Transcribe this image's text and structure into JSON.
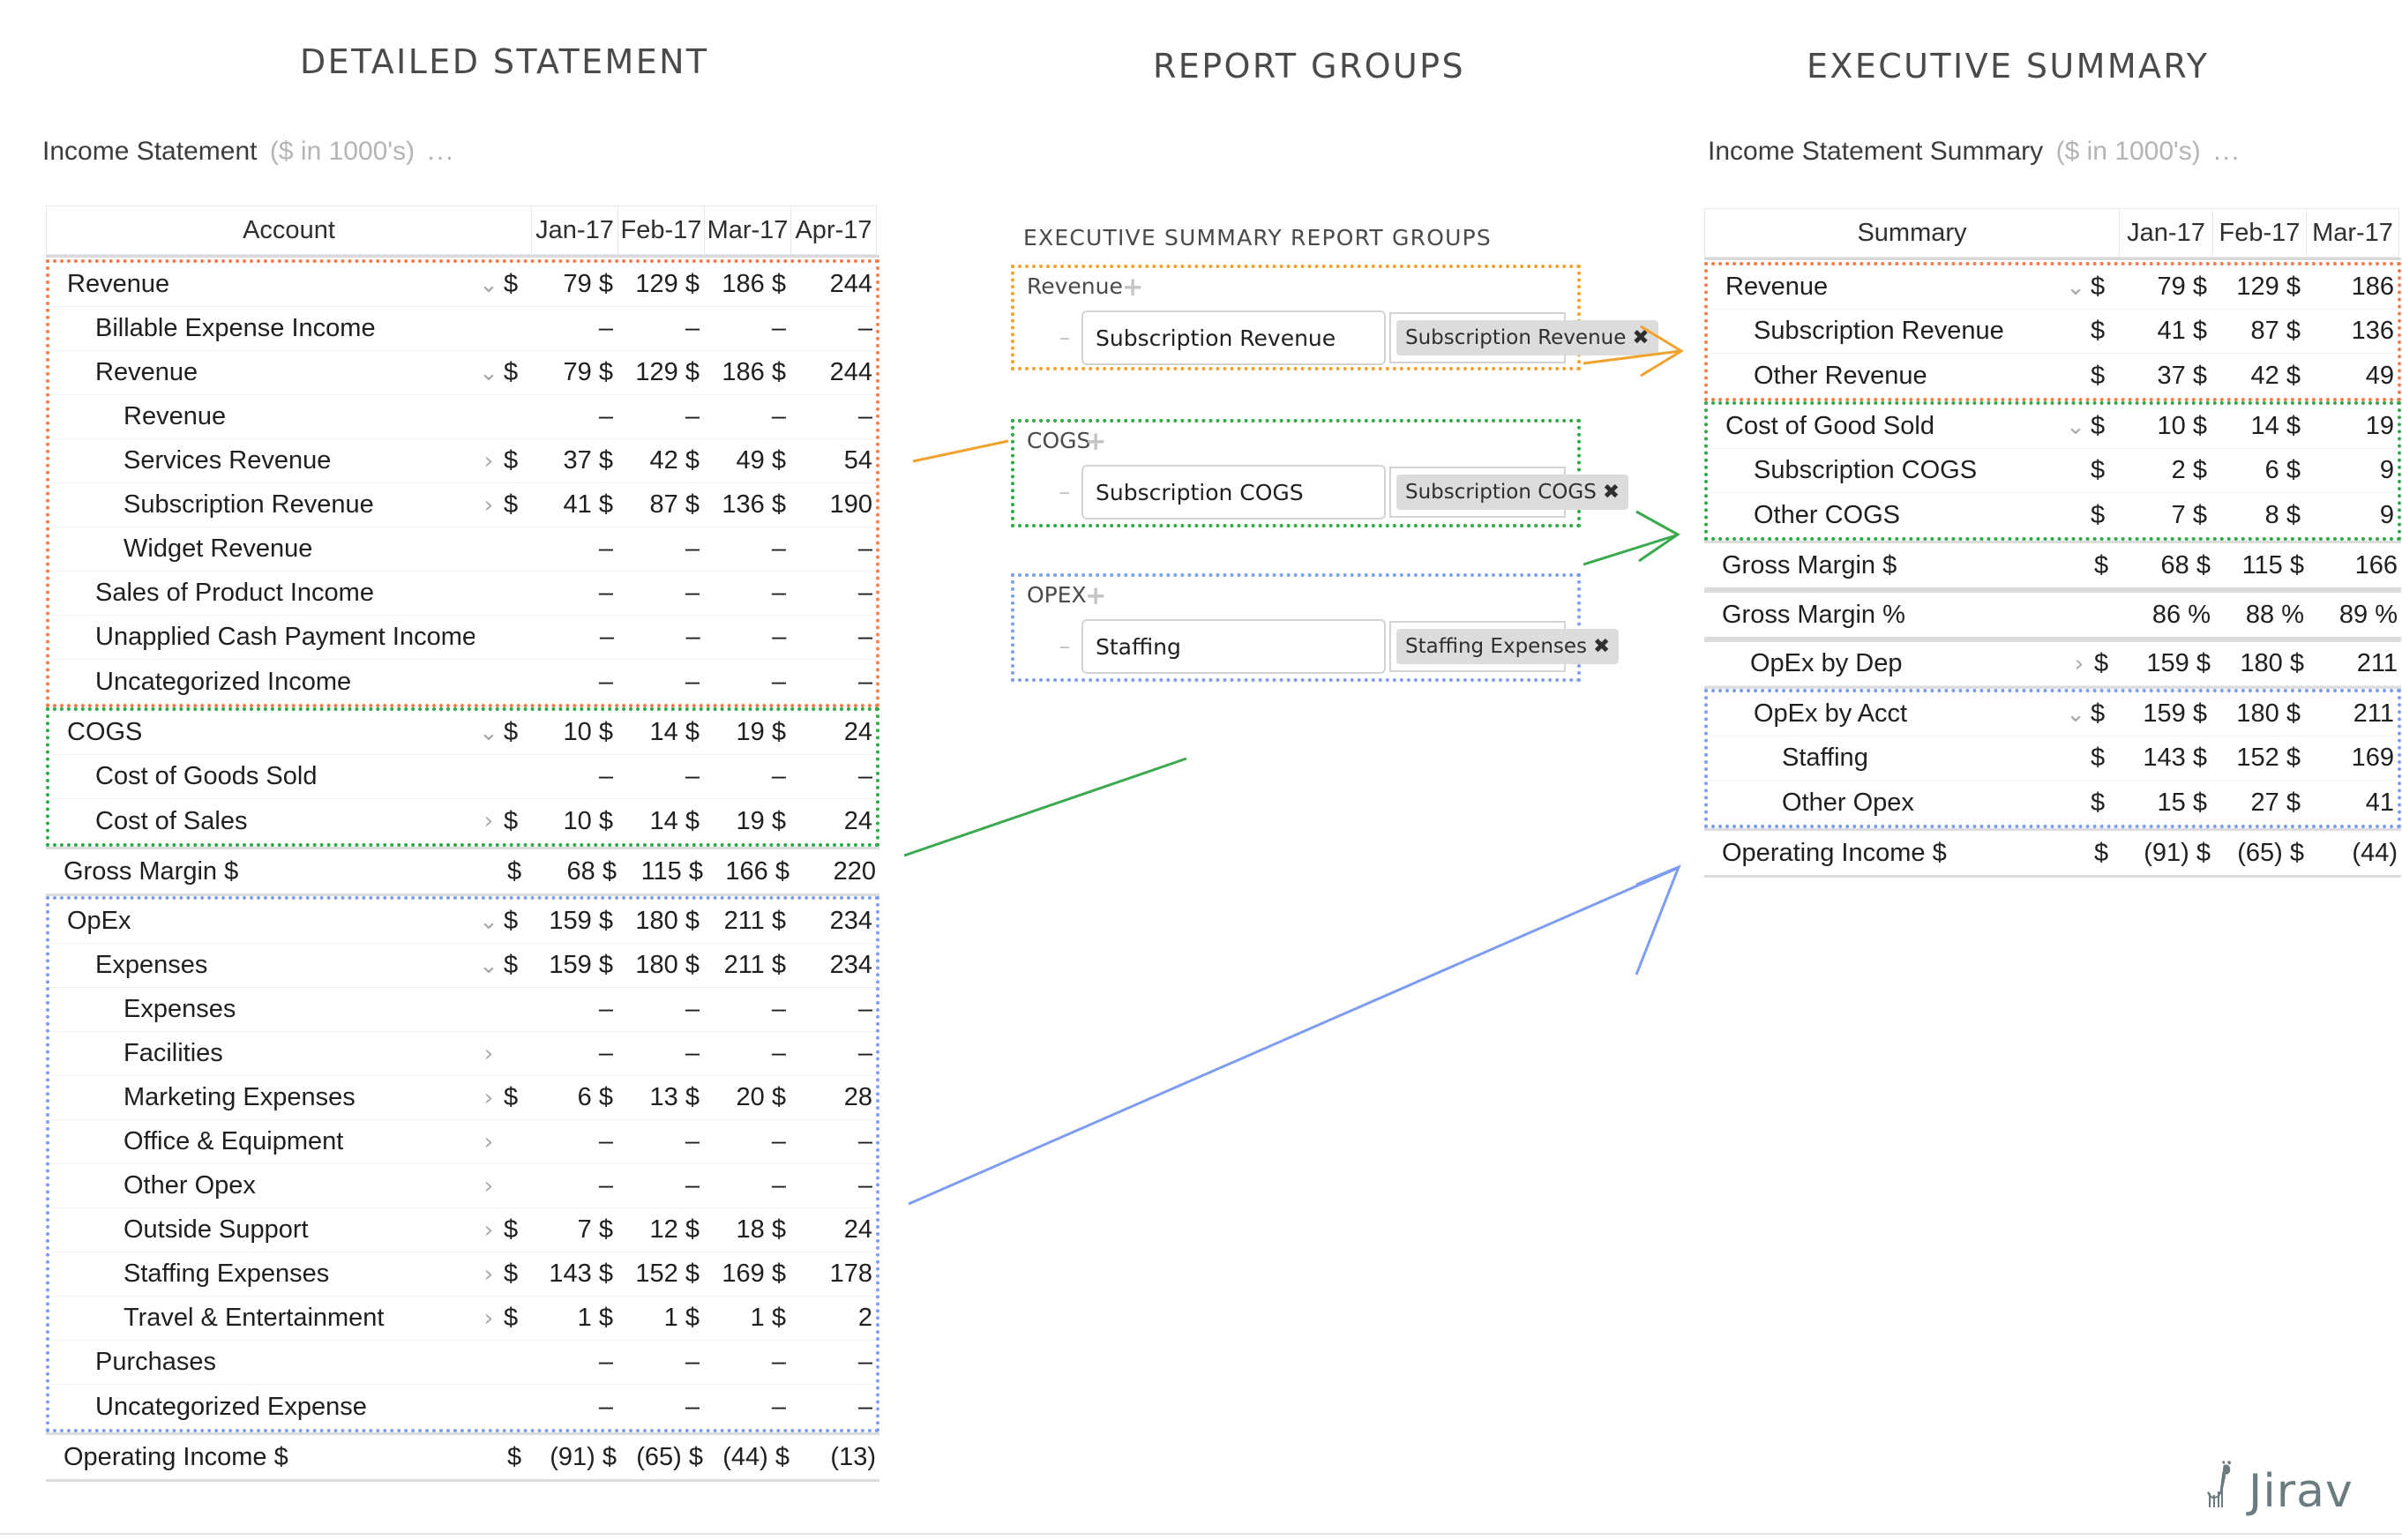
{
  "panels": {
    "detailed_title": "DETAILED STATEMENT",
    "groups_title": "REPORT GROUPS",
    "exec_title": "EXECUTIVE SUMMARY"
  },
  "detailed": {
    "caption_name": "Income Statement",
    "caption_units": "($ in 1000's)",
    "caption_dots": "...",
    "columns": [
      "Account",
      "Jan-17",
      "Feb-17",
      "Mar-17",
      "Apr-17"
    ],
    "rows": [
      {
        "label": "Revenue",
        "indent": 0,
        "caret": "down",
        "dollar": "$",
        "values": [
          "79 $",
          "129 $",
          "186 $",
          "244"
        ],
        "group": "rev"
      },
      {
        "label": "Billable Expense Income",
        "indent": 1,
        "caret": "",
        "dollar": "",
        "values": [
          "–",
          "–",
          "–",
          "–"
        ],
        "group": "rev"
      },
      {
        "label": "Revenue",
        "indent": 1,
        "caret": "down",
        "dollar": "$",
        "values": [
          "79 $",
          "129 $",
          "186 $",
          "244"
        ],
        "group": "rev"
      },
      {
        "label": "Revenue",
        "indent": 2,
        "caret": "",
        "dollar": "",
        "values": [
          "–",
          "–",
          "–",
          "–"
        ],
        "group": "rev"
      },
      {
        "label": "Services Revenue",
        "indent": 2,
        "caret": "right",
        "dollar": "$",
        "values": [
          "37 $",
          "42 $",
          "49 $",
          "54"
        ],
        "group": "rev"
      },
      {
        "label": "Subscription Revenue",
        "indent": 2,
        "caret": "right",
        "dollar": "$",
        "values": [
          "41 $",
          "87 $",
          "136 $",
          "190"
        ],
        "group": "rev"
      },
      {
        "label": "Widget Revenue",
        "indent": 2,
        "caret": "",
        "dollar": "",
        "values": [
          "–",
          "–",
          "–",
          "–"
        ],
        "group": "rev"
      },
      {
        "label": "Sales of Product Income",
        "indent": 1,
        "caret": "",
        "dollar": "",
        "values": [
          "–",
          "–",
          "–",
          "–"
        ],
        "group": "rev"
      },
      {
        "label": "Unapplied Cash Payment Income",
        "indent": 1,
        "caret": "",
        "dollar": "",
        "values": [
          "–",
          "–",
          "–",
          "–"
        ],
        "group": "rev"
      },
      {
        "label": "Uncategorized Income",
        "indent": 1,
        "caret": "",
        "dollar": "",
        "values": [
          "–",
          "–",
          "–",
          "–"
        ],
        "group": "rev"
      },
      {
        "label": "COGS",
        "indent": 0,
        "caret": "down",
        "dollar": "$",
        "values": [
          "10 $",
          "14 $",
          "19 $",
          "24"
        ],
        "group": "cogs"
      },
      {
        "label": "Cost of Goods Sold",
        "indent": 1,
        "caret": "",
        "dollar": "",
        "values": [
          "–",
          "–",
          "–",
          "–"
        ],
        "group": "cogs"
      },
      {
        "label": "Cost of Sales",
        "indent": 1,
        "caret": "right",
        "dollar": "$",
        "values": [
          "10 $",
          "14 $",
          "19 $",
          "24"
        ],
        "group": "cogs"
      },
      {
        "label": "Gross Margin $",
        "indent": 0,
        "caret": "",
        "dollar": "$",
        "values": [
          "68 $",
          "115 $",
          "166 $",
          "220"
        ],
        "group": "none",
        "total": true
      },
      {
        "label": "OpEx",
        "indent": 0,
        "caret": "down",
        "dollar": "$",
        "values": [
          "159 $",
          "180 $",
          "211 $",
          "234"
        ],
        "group": "opex"
      },
      {
        "label": "Expenses",
        "indent": 1,
        "caret": "down",
        "dollar": "$",
        "values": [
          "159 $",
          "180 $",
          "211 $",
          "234"
        ],
        "group": "opex"
      },
      {
        "label": "Expenses",
        "indent": 2,
        "caret": "",
        "dollar": "",
        "values": [
          "–",
          "–",
          "–",
          "–"
        ],
        "group": "opex"
      },
      {
        "label": "Facilities",
        "indent": 2,
        "caret": "right",
        "dollar": "",
        "values": [
          "–",
          "–",
          "–",
          "–"
        ],
        "group": "opex"
      },
      {
        "label": "Marketing Expenses",
        "indent": 2,
        "caret": "right",
        "dollar": "$",
        "values": [
          "6 $",
          "13 $",
          "20 $",
          "28"
        ],
        "group": "opex"
      },
      {
        "label": "Office & Equipment",
        "indent": 2,
        "caret": "right",
        "dollar": "",
        "values": [
          "–",
          "–",
          "–",
          "–"
        ],
        "group": "opex"
      },
      {
        "label": "Other Opex",
        "indent": 2,
        "caret": "right",
        "dollar": "",
        "values": [
          "–",
          "–",
          "–",
          "–"
        ],
        "group": "opex"
      },
      {
        "label": "Outside Support",
        "indent": 2,
        "caret": "right",
        "dollar": "$",
        "values": [
          "7 $",
          "12 $",
          "18 $",
          "24"
        ],
        "group": "opex"
      },
      {
        "label": "Staffing Expenses",
        "indent": 2,
        "caret": "right",
        "dollar": "$",
        "values": [
          "143 $",
          "152 $",
          "169 $",
          "178"
        ],
        "group": "opex"
      },
      {
        "label": "Travel & Entertainment",
        "indent": 2,
        "caret": "right",
        "dollar": "$",
        "values": [
          "1 $",
          "1 $",
          "1 $",
          "2"
        ],
        "group": "opex"
      },
      {
        "label": "Purchases",
        "indent": 1,
        "caret": "",
        "dollar": "",
        "values": [
          "–",
          "–",
          "–",
          "–"
        ],
        "group": "opex"
      },
      {
        "label": "Uncategorized Expense",
        "indent": 1,
        "caret": "",
        "dollar": "",
        "values": [
          "–",
          "–",
          "–",
          "–"
        ],
        "group": "opex"
      },
      {
        "label": "Operating Income $",
        "indent": 0,
        "caret": "",
        "dollar": "$",
        "values": [
          "(91) $",
          "(65) $",
          "(44) $",
          "(13)"
        ],
        "group": "none",
        "total": true
      }
    ]
  },
  "groups": {
    "section_label": "EXECUTIVE SUMMARY REPORT GROUPS",
    "add_icon": "+",
    "remove_icon": "–",
    "remove_tag_icon": "✖",
    "items": [
      {
        "name": "Revenue",
        "input_value": "Subscription Revenue",
        "tag": "Subscription Revenue",
        "color": "#f0a22e"
      },
      {
        "name": "COGS",
        "input_value": "Subscription COGS",
        "tag": "Subscription COGS",
        "color": "#2eaa4a"
      },
      {
        "name": "OPEX",
        "input_value": "Staffing",
        "tag": "Staffing Expenses",
        "color": "#7d9ef0"
      }
    ]
  },
  "exec": {
    "caption_name": "Income Statement Summary",
    "caption_units": "($ in 1000's)",
    "caption_dots": "...",
    "columns": [
      "Summary",
      "Jan-17",
      "Feb-17",
      "Mar-17"
    ],
    "rows": [
      {
        "label": "Revenue",
        "indent": 0,
        "caret": "down",
        "dollar": "$",
        "values": [
          "79 $",
          "129 $",
          "186"
        ],
        "group": "rev"
      },
      {
        "label": "Subscription Revenue",
        "indent": 1,
        "caret": "",
        "dollar": "$",
        "values": [
          "41 $",
          "87 $",
          "136"
        ],
        "group": "rev"
      },
      {
        "label": "Other Revenue",
        "indent": 1,
        "caret": "",
        "dollar": "$",
        "values": [
          "37 $",
          "42 $",
          "49"
        ],
        "group": "rev"
      },
      {
        "label": "Cost of Good Sold",
        "indent": 0,
        "caret": "down",
        "dollar": "$",
        "values": [
          "10 $",
          "14 $",
          "19"
        ],
        "group": "cogs"
      },
      {
        "label": "Subscription COGS",
        "indent": 1,
        "caret": "",
        "dollar": "$",
        "values": [
          "2 $",
          "6 $",
          "9"
        ],
        "group": "cogs"
      },
      {
        "label": "Other COGS",
        "indent": 1,
        "caret": "",
        "dollar": "$",
        "values": [
          "7 $",
          "8 $",
          "9"
        ],
        "group": "cogs"
      },
      {
        "label": "Gross Margin $",
        "indent": 0,
        "caret": "",
        "dollar": "$",
        "values": [
          "68 $",
          "115 $",
          "166"
        ],
        "group": "none",
        "total": true
      },
      {
        "label": "Gross Margin %",
        "indent": 0,
        "caret": "",
        "dollar": "",
        "values": [
          "86 %",
          "88 %",
          "89 %"
        ],
        "group": "none",
        "total": true
      },
      {
        "label": "OpEx by Dep",
        "indent": 1,
        "caret": "right",
        "dollar": "$",
        "values": [
          "159 $",
          "180 $",
          "211"
        ],
        "group": "none"
      },
      {
        "label": "OpEx by Acct",
        "indent": 1,
        "caret": "down",
        "dollar": "$",
        "values": [
          "159 $",
          "180 $",
          "211"
        ],
        "group": "opex"
      },
      {
        "label": "Staffing",
        "indent": 2,
        "caret": "",
        "dollar": "$",
        "values": [
          "143 $",
          "152 $",
          "169"
        ],
        "group": "opex"
      },
      {
        "label": "Other Opex",
        "indent": 2,
        "caret": "",
        "dollar": "$",
        "values": [
          "15 $",
          "27 $",
          "41"
        ],
        "group": "opex"
      },
      {
        "label": "Operating Income $",
        "indent": 0,
        "caret": "",
        "dollar": "$",
        "values": [
          "(91) $",
          "(65) $",
          "(44)"
        ],
        "group": "none",
        "total": true
      }
    ]
  },
  "logo": {
    "word": "Jirav"
  },
  "colors": {
    "revenue": "#f08050",
    "cogs": "#2eaa4a",
    "opex": "#7d9ef0",
    "group_revenue": "#f0a22e",
    "text": "#1f1f1f",
    "muted": "#b4b4b4"
  },
  "icons": {
    "caret_down": "⌄",
    "caret_right": "›"
  }
}
